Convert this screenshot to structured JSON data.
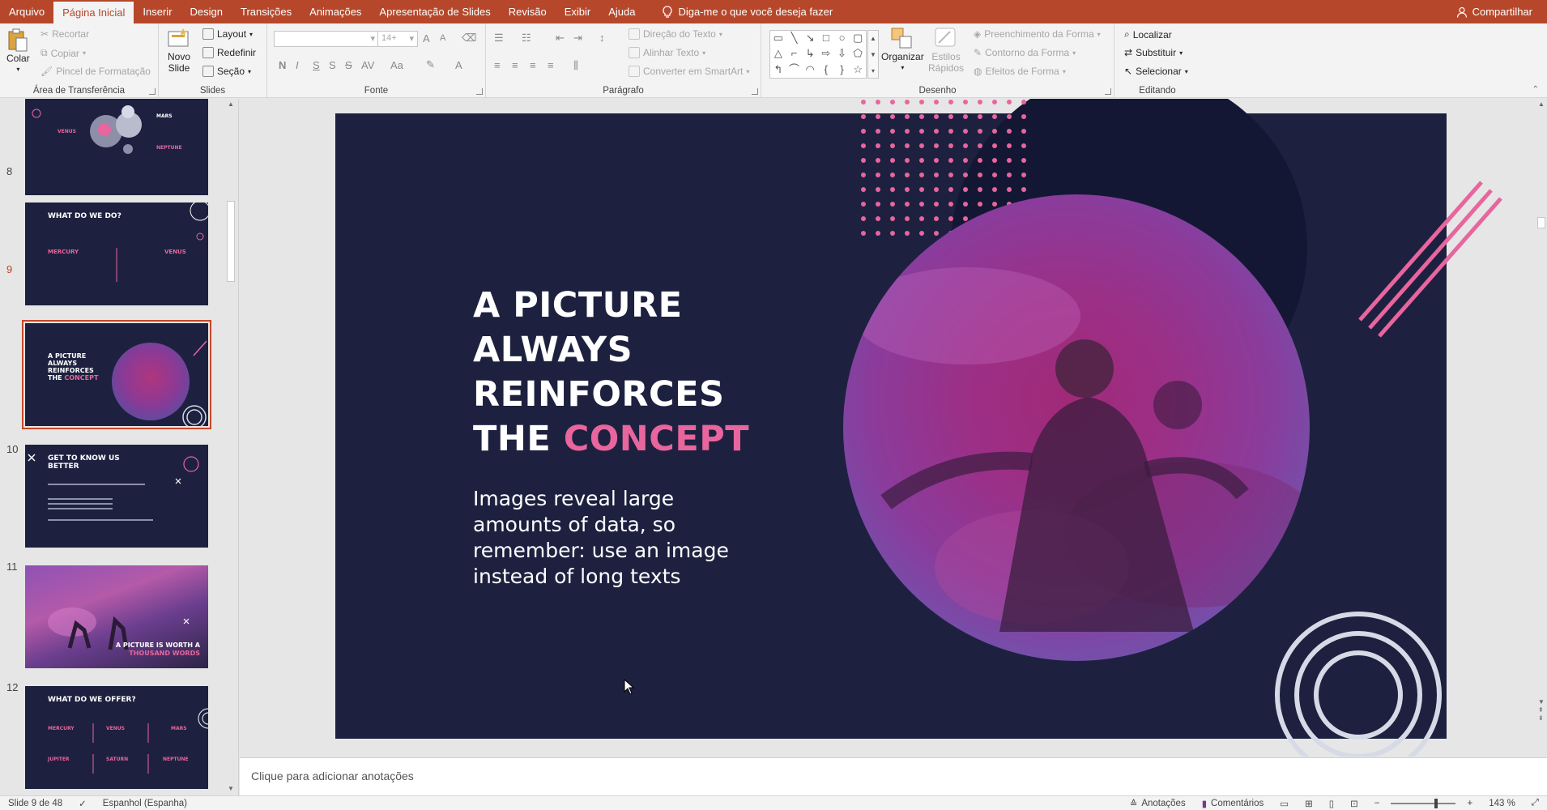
{
  "menu": {
    "tabs": [
      "Arquivo",
      "Página Inicial",
      "Inserir",
      "Design",
      "Transições",
      "Animações",
      "Apresentação de Slides",
      "Revisão",
      "Exibir",
      "Ajuda"
    ],
    "active_index": 1,
    "tell_me": "Diga-me o que você deseja fazer",
    "share": "Compartilhar"
  },
  "ribbon": {
    "clipboard": {
      "label": "Área de Transferência",
      "paste": "Colar",
      "cut": "Recortar",
      "copy": "Copiar",
      "format_painter": "Pincel de Formatação"
    },
    "slides": {
      "label": "Slides",
      "new_slide_line1": "Novo",
      "new_slide_line2": "Slide",
      "layout": "Layout",
      "reset": "Redefinir",
      "section": "Seção"
    },
    "font": {
      "label": "Fonte",
      "size": "14+",
      "bold": "N",
      "italic": "I",
      "underline": "S",
      "strike": "S",
      "shadow": "S",
      "spacing": "AV",
      "case": "Aa",
      "color": "A",
      "grow": "A",
      "shrink": "A"
    },
    "paragraph": {
      "label": "Parágrafo",
      "text_direction": "Direção do Texto",
      "align_text": "Alinhar Texto",
      "smartart": "Converter em SmartArt"
    },
    "drawing": {
      "label": "Desenho",
      "arrange": "Organizar",
      "quick_styles_1": "Estilos",
      "quick_styles_2": "Rápidos",
      "shape_fill": "Preenchimento da Forma",
      "shape_outline": "Contorno da Forma",
      "shape_effects": "Efeitos de Forma"
    },
    "editing": {
      "label": "Editando",
      "find": "Localizar",
      "replace": "Substituir",
      "select": "Selecionar"
    }
  },
  "thumbnails": [
    {
      "num": "",
      "kind": "planets",
      "labels": {
        "a": "VENUS",
        "b": "MARS",
        "c": "NEPTUNE"
      }
    },
    {
      "num": "8",
      "kind": "whatwedo",
      "title": "WHAT DO WE DO?",
      "left": "MERCURY",
      "right": "VENUS"
    },
    {
      "num": "9",
      "kind": "picture",
      "title1": "A PICTURE",
      "title2": "ALWAYS",
      "title3": "REINFORCES",
      "title4": "THE",
      "title_hl": "CONCEPT",
      "selected": true
    },
    {
      "num": "10",
      "kind": "getto",
      "title1": "GET TO KNOW US",
      "title2": "BETTER"
    },
    {
      "num": "11",
      "kind": "photo",
      "title1": "A PICTURE IS WORTH A",
      "title_hl": "THOUSAND WORDS"
    },
    {
      "num": "12",
      "kind": "offer",
      "title": "WHAT DO WE OFFER?",
      "c1": "MERCURY",
      "c2": "VENUS",
      "c3": "MARS",
      "c4": "JUPITER",
      "c5": "SATURN",
      "c6": "NEPTUNE"
    }
  ],
  "slide": {
    "title_line1": "A PICTURE",
    "title_line2": "ALWAYS",
    "title_line3": "REINFORCES",
    "title_line4": "THE",
    "title_highlight": "CONCEPT",
    "body": "Images reveal large amounts of data, so remember: use an image instead of long texts",
    "accent": "#e8659e",
    "background": "#1d213f"
  },
  "notes_placeholder": "Clique para adicionar anotações",
  "status": {
    "slide_info": "Slide 9 de 48",
    "language": "Espanhol (Espanha)",
    "notes": "Anotações",
    "comments": "Comentários",
    "zoom": "143 %"
  },
  "colors": {
    "brand": "#b7472a",
    "ribbon": "#f3f3f3"
  }
}
